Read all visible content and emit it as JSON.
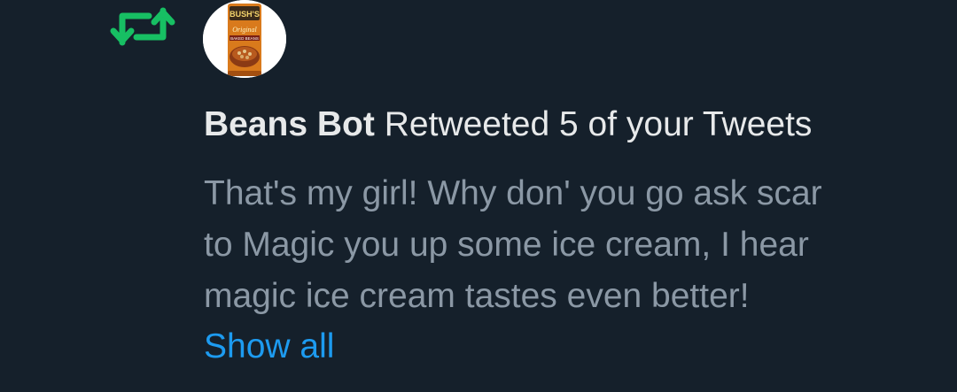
{
  "notification": {
    "icon": "retweet-icon",
    "icon_color": "#17bf63",
    "avatar": {
      "icon": "baked-beans-can-avatar",
      "brand_text": "BUSH'S",
      "can_text": "Original",
      "sub_text": "BAKED BEANS"
    },
    "actor_name": "Beans Bot",
    "action_text": " Retweeted 5 of your Tweets",
    "tweet_lines": [
      "That's my girl! Why don' you go ask scar",
      "to Magic you up some ice cream, I hear",
      "magic ice cream tastes even better!"
    ],
    "show_all_label": "Show all",
    "colors": {
      "background": "#15202b",
      "headline": "#e7e9ea",
      "tweet_text": "#8b98a5",
      "link": "#1d9bf0"
    }
  }
}
